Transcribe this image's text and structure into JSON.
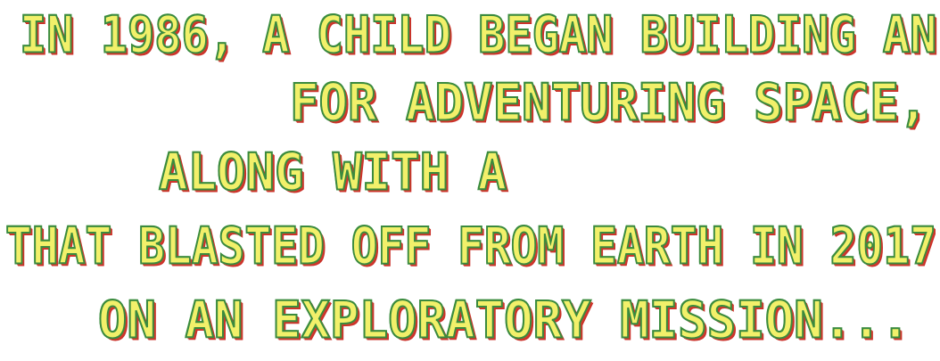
{
  "intro": {
    "lines": [
      "IN 1986, A CHILD BEGAN BUILDING AN",
      "FOR ADVENTURING SPACE,",
      "ALONG WITH A",
      "THAT BLASTED OFF FROM EARTH IN 2017",
      "ON AN EXPLORATORY MISSION..."
    ]
  },
  "colors": {
    "fill": "#f2f06a",
    "outline": "#3a8a3e",
    "shadow": "#d2392b"
  }
}
